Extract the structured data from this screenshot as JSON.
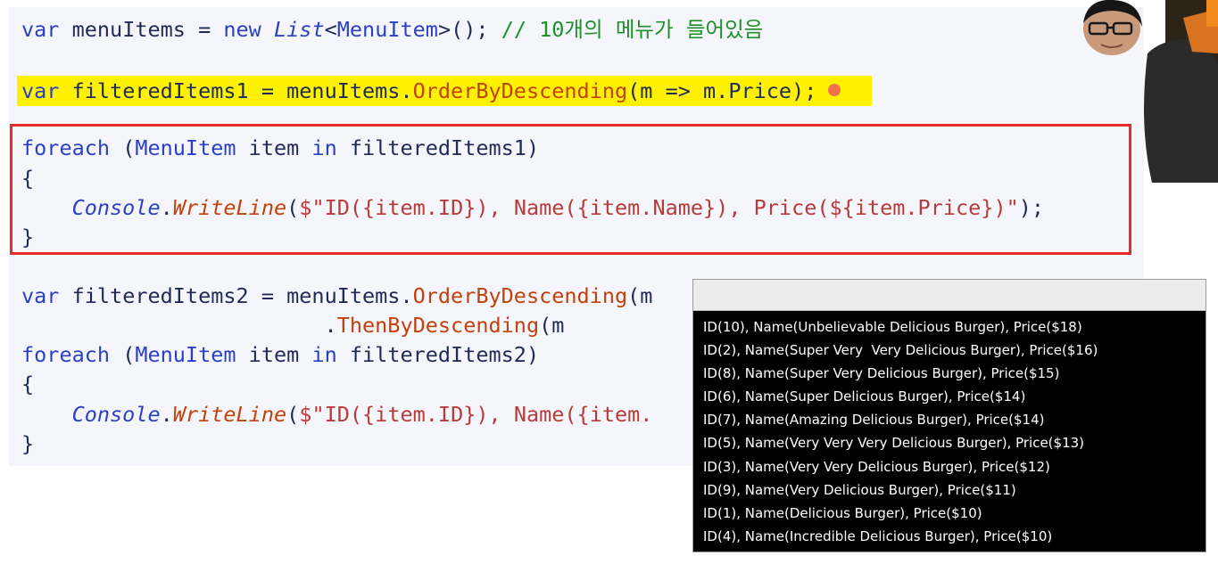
{
  "code": {
    "line1": {
      "t1": "var",
      "t2": " menuItems = ",
      "t3": "new",
      "t4": " ",
      "t5": "List",
      "t6": "<",
      "t7": "MenuItem",
      "t8": ">(); ",
      "t9": "// 10개의 메뉴가 들어있음"
    },
    "line2": {
      "t1": "var",
      "t2": " filteredItems1 = menuItems.",
      "t3": "OrderByDescending",
      "t4": "(m => m.Price);"
    },
    "line3": {
      "t1": "foreach",
      "t2": " (",
      "t3": "MenuItem",
      "t4": " item ",
      "t5": "in",
      "t6": " filteredItems1)"
    },
    "line4": "{",
    "line5": {
      "t1": "    ",
      "t2": "Console",
      "t3": ".",
      "t4": "WriteLine",
      "t5": "(",
      "t6": "$\"ID({item.ID}), Name({item.Name}), Price(${item.Price})\"",
      "t7": ");"
    },
    "line6": "}",
    "line7": {
      "t1": "var",
      "t2": " filteredItems2 = menuItems.",
      "t3": "OrderByDescending",
      "t4": "(m"
    },
    "line8": {
      "t1": "                        .",
      "t2": "ThenByDescending",
      "t3": "(m"
    },
    "line9": {
      "t1": "foreach",
      "t2": " (",
      "t3": "MenuItem",
      "t4": " item ",
      "t5": "in",
      "t6": " filteredItems2)"
    },
    "line10": "{",
    "line11": {
      "t1": "    ",
      "t2": "Console",
      "t3": ".",
      "t4": "WriteLine",
      "t5": "(",
      "t6": "$\"ID({item.ID}), Name({item.",
      "t7": ""
    },
    "line12": "}"
  },
  "console": {
    "title": "",
    "output": [
      "ID(10), Name(Unbelievable Delicious Burger), Price($18)",
      "ID(2), Name(Super Very  Very Delicious Burger), Price($16)",
      "ID(8), Name(Super Very Delicious Burger), Price($15)",
      "ID(6), Name(Super Delicious Burger), Price($14)",
      "ID(7), Name(Amazing Delicious Burger), Price($14)",
      "ID(5), Name(Very Very Very Delicious Burger), Price($13)",
      "ID(3), Name(Very Very Delicious Burger), Price($12)",
      "ID(9), Name(Very Delicious Burger), Price($11)",
      "ID(1), Name(Delicious Burger), Price($10)",
      "ID(4), Name(Incredible Delicious Burger), Price($10)"
    ]
  },
  "colors": {
    "keyword": "#2b3fc4",
    "method": "#c2410c",
    "comment": "#1f8f2a",
    "string": "#b83a3a",
    "highlight": "#fff200",
    "selection_border": "#e52a2a"
  },
  "icons": {
    "presenter": "presenter-webcam-overlay"
  }
}
